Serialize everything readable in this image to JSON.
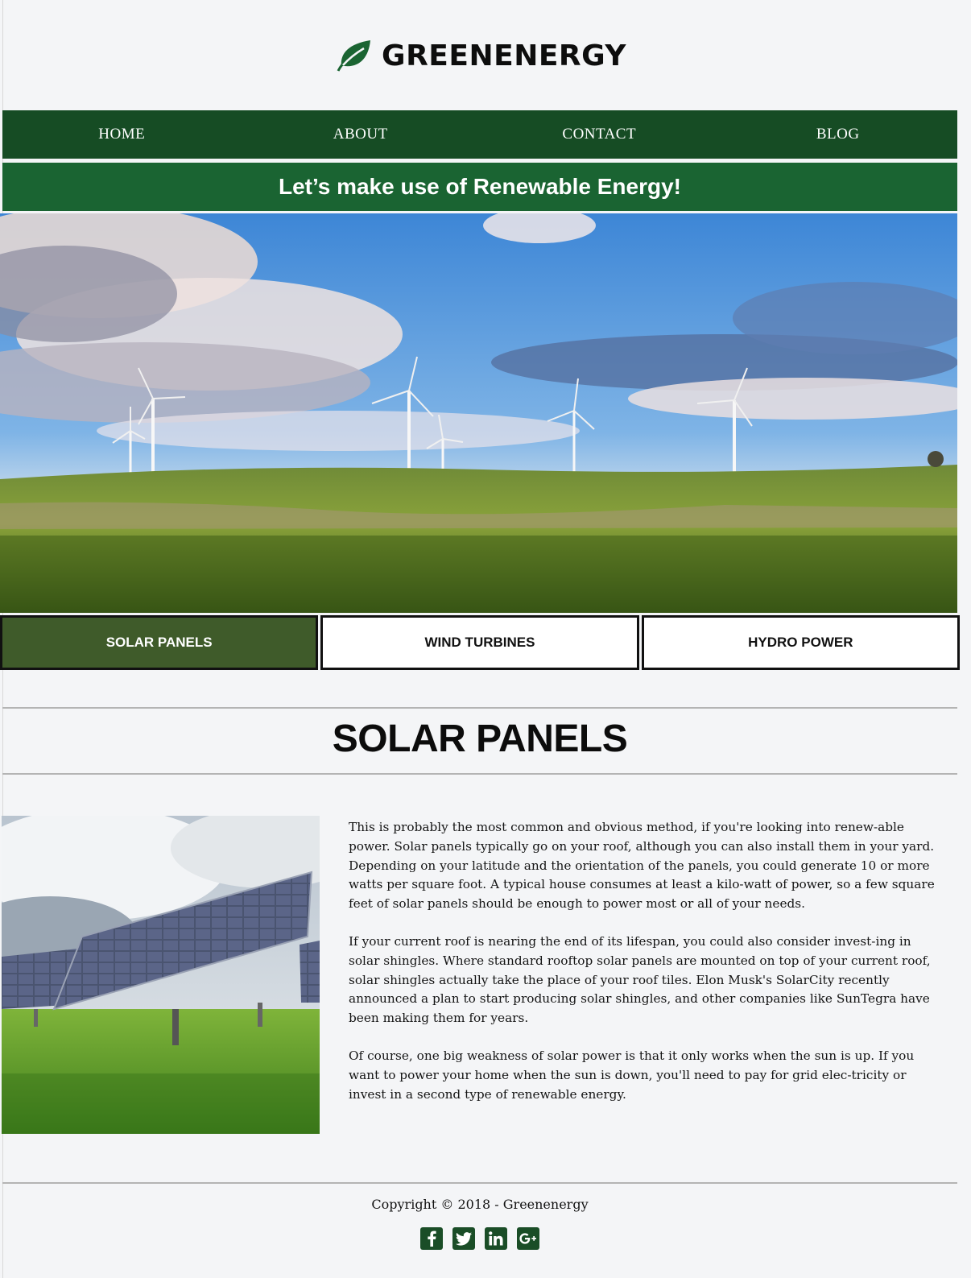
{
  "brand": {
    "name": "GREENENERGY",
    "color": "#1a6432"
  },
  "nav": {
    "items": [
      "HOME",
      "ABOUT",
      "CONTACT",
      "BLOG"
    ]
  },
  "banner": {
    "text": "Let’s make use of Renewable Energy!"
  },
  "tabs": [
    {
      "label": "SOLAR PANELS",
      "active": true
    },
    {
      "label": "WIND TURBINES",
      "active": false
    },
    {
      "label": "HYDRO POWER",
      "active": false
    }
  ],
  "section": {
    "title": "SOLAR PANELS",
    "paragraphs": [
      "This is probably the most common and obvious method, if you're looking into renew-able power. Solar panels typically go on your roof, although you can also install them in your yard. Depending on your latitude and the orientation of the panels, you could generate 10 or more watts per square foot. A typical house consumes at least a kilo-watt of power, so a few square feet of solar panels should be enough to power most or all of your needs.",
      "If your current roof is nearing the end of its lifespan, you could also consider invest-ing in solar shingles. Where standard rooftop solar panels are mounted on top of your current roof, solar shingles actually take the place of your roof tiles. Elon Musk's SolarCity recently announced a plan to start producing solar shingles, and other companies like SunTegra have been making them for years.",
      "Of course, one big weakness of solar power is that it only works when the sun is up. If you want to power your home when the sun is down, you'll need to pay for grid elec-tricity or invest in a second type of renewable energy."
    ]
  },
  "footer": {
    "copyright": "Copyright © 2018 - Greenenergy",
    "social": [
      "facebook-icon",
      "twitter-icon",
      "linkedin-icon",
      "google-plus-icon"
    ]
  },
  "colors": {
    "nav_bg": "#164c24",
    "banner_bg": "#1a6432",
    "active_tab": "#3f5b2a",
    "page_bg": "#f4f5f7"
  }
}
